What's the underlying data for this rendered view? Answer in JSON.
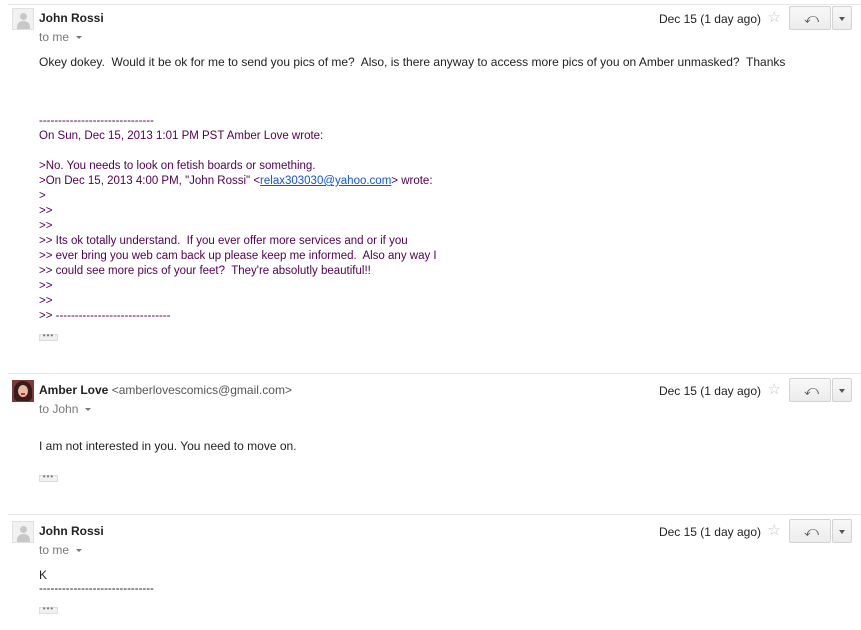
{
  "messages": [
    {
      "sender": "John Rossi",
      "sender_email": "",
      "to": "to me",
      "date": "Dec 15 (1 day ago)",
      "body": "Okey dokey.  Would it be ok for me to send you pics of me?  Also, is there anyway to access more pics of you on Amber unmasked?  Thanks",
      "quoted": {
        "dashes": "------------------------------",
        "attribution": "On Sun, Dec 15, 2013 1:01 PM PST Amber Love wrote:",
        "line1": ">No. You needs to look on fetish boards or something.",
        "line2_pre": ">On Dec 15, 2013 4:00 PM, \"John Rossi\" <",
        "line2_link": "relax303030@yahoo.com",
        "line2_post": "> wrote:",
        "line3": ">",
        "line4": ">>",
        "line5": ">>",
        "line6": ">> Its ok totally understand.  If you ever offer more services and or if you",
        "line7": ">> ever bring you web cam back up please keep me informed.  Also any way I",
        "line8": ">> could see more pics of your feet?  They're absolutly beautiful!!",
        "line9": ">>",
        "line10": ">>",
        "line11": ">> ------------------------------"
      }
    },
    {
      "sender": "Amber Love",
      "sender_email": "<amberlovescomics@gmail.com>",
      "to": "to John",
      "date": "Dec 15 (1 day ago)",
      "body": "I am not interested in you. You need to move on."
    },
    {
      "sender": "John Rossi",
      "sender_email": "",
      "to": "to me",
      "date": "Dec 15 (1 day ago)",
      "body": "K",
      "dashes": "------------------------------"
    }
  ],
  "icons": {
    "star": "☆",
    "reply": "⤺",
    "ellipsis": "•••"
  }
}
